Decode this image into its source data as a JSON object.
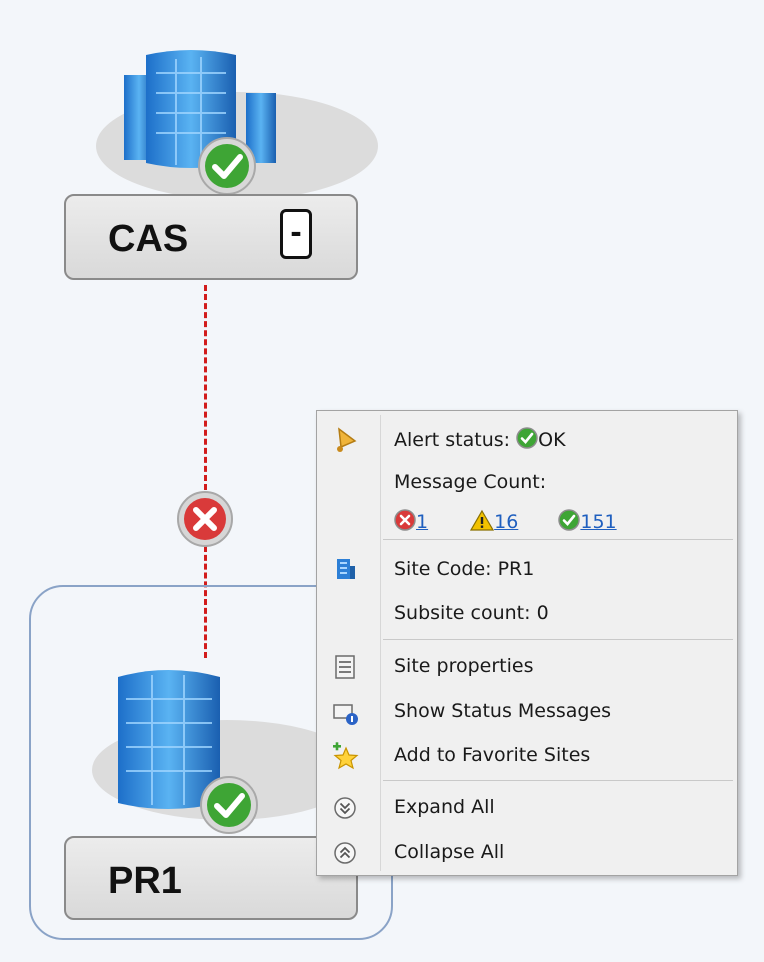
{
  "nodes": {
    "cas": {
      "label": "CAS",
      "toggle": "-"
    },
    "pr1": {
      "label": "PR1"
    }
  },
  "context_menu": {
    "alert_status_label": "Alert status:",
    "alert_status_value": "OK",
    "message_count_label": "Message Count:",
    "counts": {
      "error": "1",
      "warning": "16",
      "ok": "151"
    },
    "site_code": "Site Code: PR1",
    "subsite_count": "Subsite count: 0",
    "site_properties": "Site properties",
    "show_status_messages": "Show Status Messages",
    "add_to_favorites": "Add to Favorite Sites",
    "expand_all": "Expand All",
    "collapse_all": "Collapse All"
  },
  "colors": {
    "link_line": "#d21c1c",
    "ok_green": "#3ea535",
    "error_red": "#d93a3a",
    "warning_yellow": "#f2c200",
    "link_blue": "#1f5fbf",
    "group_border": "#8aa3c7"
  },
  "icons": {
    "alert": "bell-icon",
    "site": "site-building-icon",
    "properties": "properties-icon",
    "status_messages": "status-messages-icon",
    "favorites": "favorite-star-icon",
    "expand": "expand-all-icon",
    "collapse": "collapse-all-icon"
  }
}
